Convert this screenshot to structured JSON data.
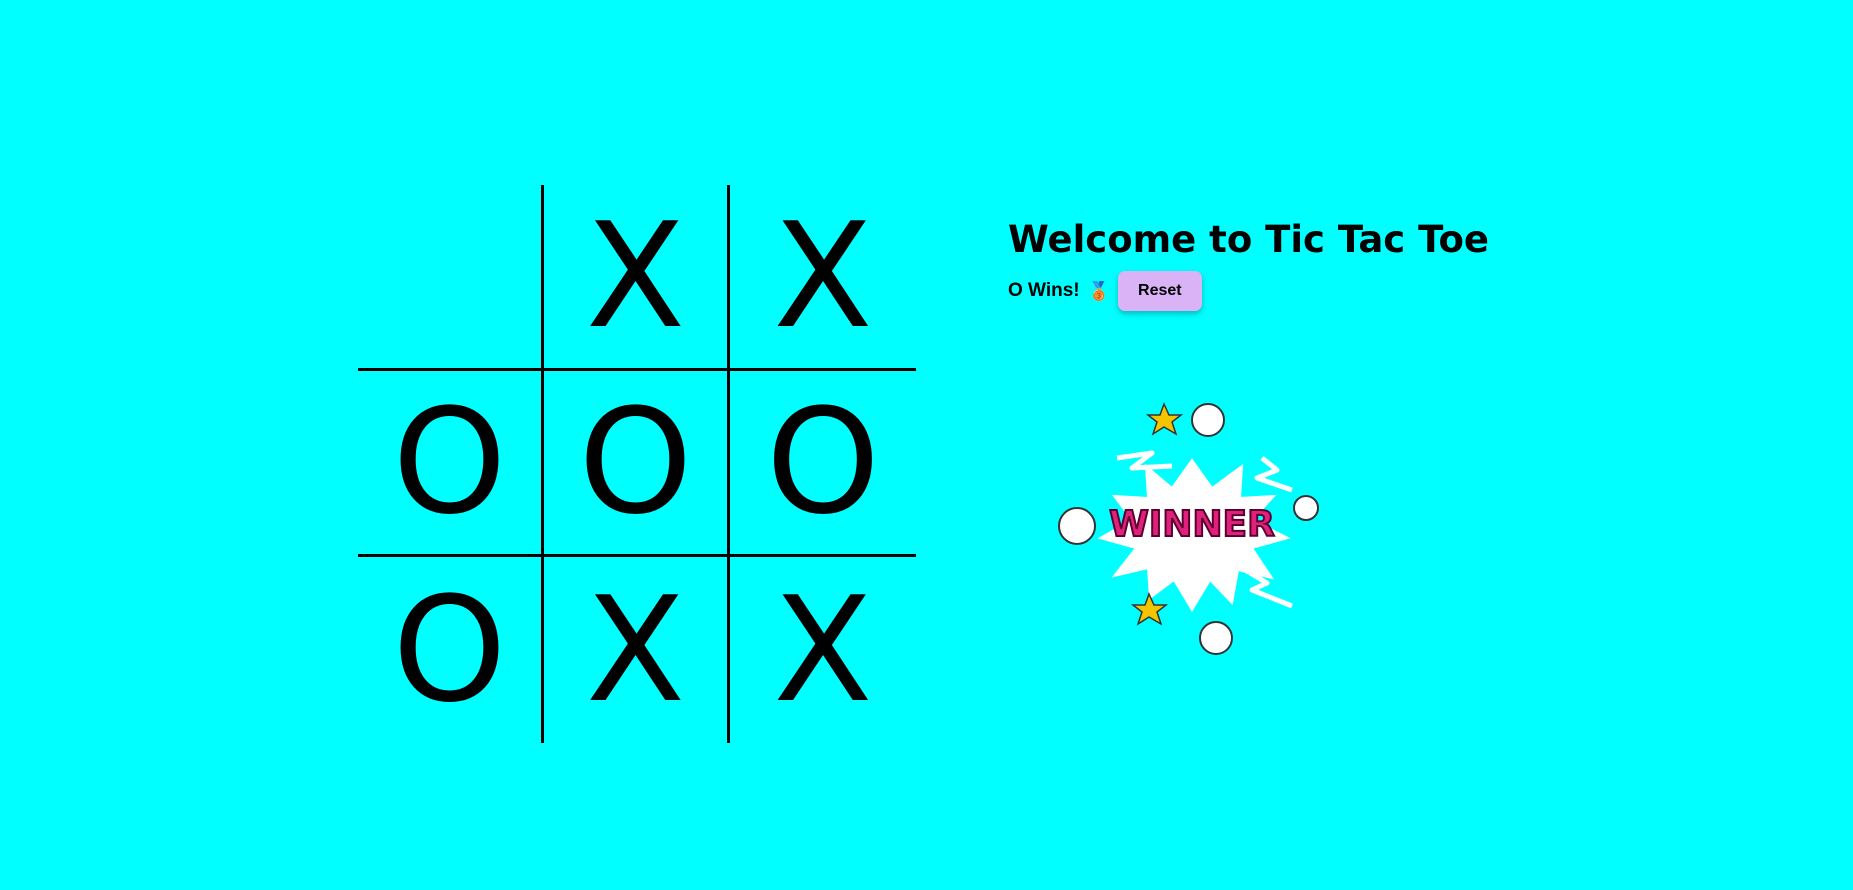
{
  "board": {
    "cells": [
      [
        "",
        "X",
        "X"
      ],
      [
        "O",
        "O",
        "O"
      ],
      [
        "O",
        "X",
        "X"
      ]
    ]
  },
  "panel": {
    "title": "Welcome to Tic Tac Toe",
    "status": "O Wins!",
    "medal_icon": "🥉",
    "reset_label": "Reset"
  },
  "winner_image": {
    "text": "WINNER",
    "icon": "winner-burst"
  },
  "colors": {
    "background": "#00ffff",
    "reset_button": "#d9b3f5",
    "winner_text": "#e0207a"
  }
}
